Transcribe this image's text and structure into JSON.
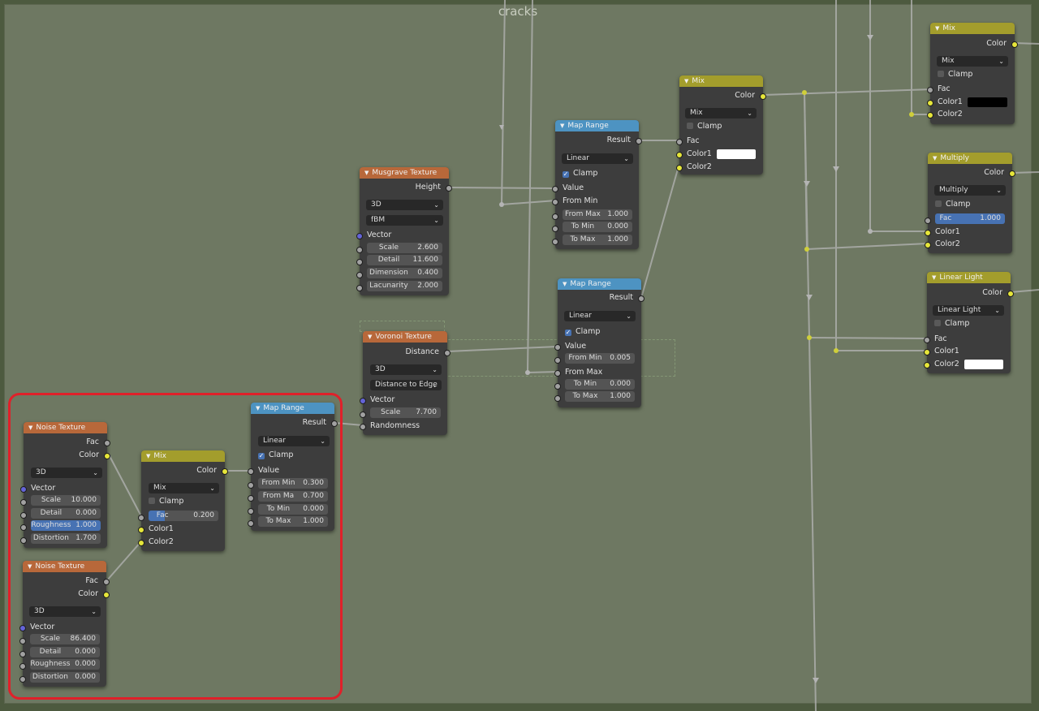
{
  "frame": {
    "title": "cracks"
  },
  "colors": {
    "texture_header": "#b8683a",
    "converter_header": "#4d93c2",
    "mix_header": "#a39d2c",
    "highlight": "#e0202a"
  },
  "nodes": {
    "noise1": {
      "title": "Noise Texture",
      "out_fac": "Fac",
      "out_color": "Color",
      "dim": "3D",
      "in_vector": "Vector",
      "scale_label": "Scale",
      "scale": "10.000",
      "detail_label": "Detail",
      "detail": "0.000",
      "roughness_label": "Roughness",
      "roughness": "1.000",
      "distortion_label": "Distortion",
      "distortion": "1.700"
    },
    "noise2": {
      "title": "Noise Texture",
      "out_fac": "Fac",
      "out_color": "Color",
      "dim": "3D",
      "in_vector": "Vector",
      "scale_label": "Scale",
      "scale": "86.400",
      "detail_label": "Detail",
      "detail": "0.000",
      "roughness_label": "Roughness",
      "roughness": "0.000",
      "distortion_label": "Distortion",
      "distortion": "0.000"
    },
    "mix_small": {
      "title": "Mix",
      "out_color": "Color",
      "mode": "Mix",
      "clamp": "Clamp",
      "fac_label": "Fac",
      "fac": "0.200",
      "color1": "Color1",
      "color2": "Color2"
    },
    "maprange_small": {
      "title": "Map Range",
      "out_result": "Result",
      "interp": "Linear",
      "clamp": "Clamp",
      "in_value": "Value",
      "from_min_label": "From Min",
      "from_min": "0.300",
      "from_max_label": "From Ma",
      "from_max": "0.700",
      "to_min_label": "To Min",
      "to_min": "0.000",
      "to_max_label": "To Max",
      "to_max": "1.000"
    },
    "musgrave": {
      "title": "Musgrave Texture",
      "out_height": "Height",
      "dim": "3D",
      "type": "fBM",
      "in_vector": "Vector",
      "scale_label": "Scale",
      "scale": "2.600",
      "detail_label": "Detail",
      "detail": "11.600",
      "dimension_label": "Dimension",
      "dimension": "0.400",
      "lacunarity_label": "Lacunarity",
      "lacunarity": "2.000"
    },
    "voronoi": {
      "title": "Voronoi Texture",
      "out_distance": "Distance",
      "dim": "3D",
      "feature": "Distance to Edge",
      "in_vector": "Vector",
      "scale_label": "Scale",
      "scale": "7.700",
      "in_randomness": "Randomness"
    },
    "maprange_a": {
      "title": "Map Range",
      "out_result": "Result",
      "interp": "Linear",
      "clamp": "Clamp",
      "in_value": "Value",
      "in_from_min": "From Min",
      "from_max_label": "From Max",
      "from_max": "1.000",
      "to_min_label": "To Min",
      "to_min": "0.000",
      "to_max_label": "To Max",
      "to_max": "1.000"
    },
    "maprange_b": {
      "title": "Map Range",
      "out_result": "Result",
      "interp": "Linear",
      "clamp": "Clamp",
      "in_value": "Value",
      "from_min_label": "From Min",
      "from_min": "0.005",
      "in_from_max": "From Max",
      "to_min_label": "To Min",
      "to_min": "0.000",
      "to_max_label": "To Max",
      "to_max": "1.000"
    },
    "mix_mid": {
      "title": "Mix",
      "out_color": "Color",
      "mode": "Mix",
      "clamp": "Clamp",
      "fac": "Fac",
      "color1": "Color1",
      "color2": "Color2",
      "color1_value": "#ffffff"
    },
    "mix_top": {
      "title": "Mix",
      "out_color": "Color",
      "mode": "Mix",
      "clamp": "Clamp",
      "fac": "Fac",
      "color1": "Color1",
      "color2": "Color2",
      "color1_value": "#000000"
    },
    "multiply": {
      "title": "Multiply",
      "out_color": "Color",
      "mode": "Multiply",
      "clamp": "Clamp",
      "fac_label": "Fac",
      "fac": "1.000",
      "color1": "Color1",
      "color2": "Color2"
    },
    "linear_light": {
      "title": "Linear Light",
      "out_color": "Color",
      "mode": "Linear Light",
      "clamp": "Clamp",
      "fac": "Fac",
      "color1": "Color1",
      "color2": "Color2",
      "color2_value": "#ffffff"
    }
  }
}
